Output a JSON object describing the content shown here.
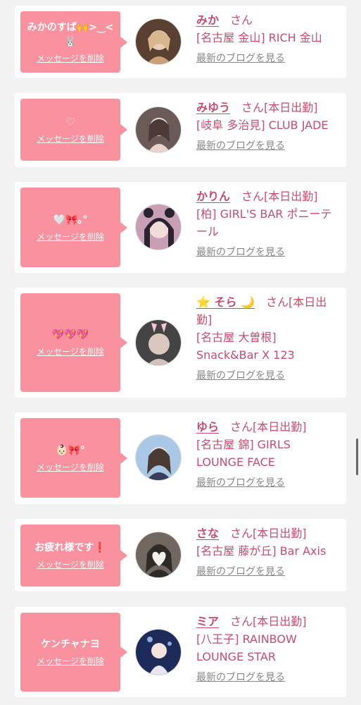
{
  "accent_color": "#f9919f",
  "name_color": "#c94c6c",
  "cards": [
    {
      "message": "みかのすぱ🙌>‿<🐰",
      "delete_label": "メッセージを削除",
      "name": "みか",
      "suffix": "　さん",
      "shop": "[名古屋 金山] RICH 金山",
      "blog_label": "最新のブログを見る",
      "avatar_colors": [
        "#c9a27a",
        "#5a4030"
      ]
    },
    {
      "message": "♡",
      "delete_label": "メッセージを削除",
      "name": "みゆう",
      "suffix": "　さん[本日出勤]",
      "shop": "[岐阜 多治見] CLUB JADE",
      "blog_label": "最新のブログを見る",
      "avatar_colors": [
        "#e8d4cc",
        "#6a5a58"
      ]
    },
    {
      "message": "🤍🎀｡°",
      "delete_label": "メッセージを削除",
      "name": "かりん",
      "suffix": "　さん[本日出勤]",
      "shop": "[柏] GIRL'S BAR ポニーテール",
      "blog_label": "最新のブログを見る",
      "avatar_colors": [
        "#2a2430",
        "#c99fb6"
      ]
    },
    {
      "message": "💖💖💖",
      "delete_label": "メッセージを削除",
      "name": "⭐️ そら 🌙",
      "suffix": "　さん[本日出勤]",
      "shop": "[名古屋 大曽根] Snack&Bar X 123",
      "blog_label": "最新のブログを見る",
      "avatar_colors": [
        "#444444",
        "#d8c8c0"
      ]
    },
    {
      "message": "👶🏻🎀°",
      "delete_label": "メッセージを削除",
      "name": "ゆら",
      "suffix": "　さん[本日出勤]",
      "shop": "[名古屋 錦] GIRLS LOUNGE FACE",
      "blog_label": "最新のブログを見る",
      "avatar_colors": [
        "#a9c8e6",
        "#3a3e5a"
      ]
    },
    {
      "message": "お疲れ様です❗️",
      "delete_label": "メッセージを削除",
      "name": "さな",
      "suffix": "　さん[本日出勤]",
      "shop": "[名古屋 藤が丘] Bar Axis",
      "blog_label": "最新のブログを見る",
      "avatar_colors": [
        "#706860",
        "#f4f0ec"
      ]
    },
    {
      "message": "ケンチャナヨ",
      "delete_label": "メッセージを削除",
      "name": "ミア",
      "suffix": "　さん[本日出勤]",
      "shop": "[八王子] RAINBOW LOUNGE STAR",
      "blog_label": "最新のブログを見る",
      "avatar_colors": [
        "#1c2b5a",
        "#8fa9d8"
      ]
    }
  ]
}
